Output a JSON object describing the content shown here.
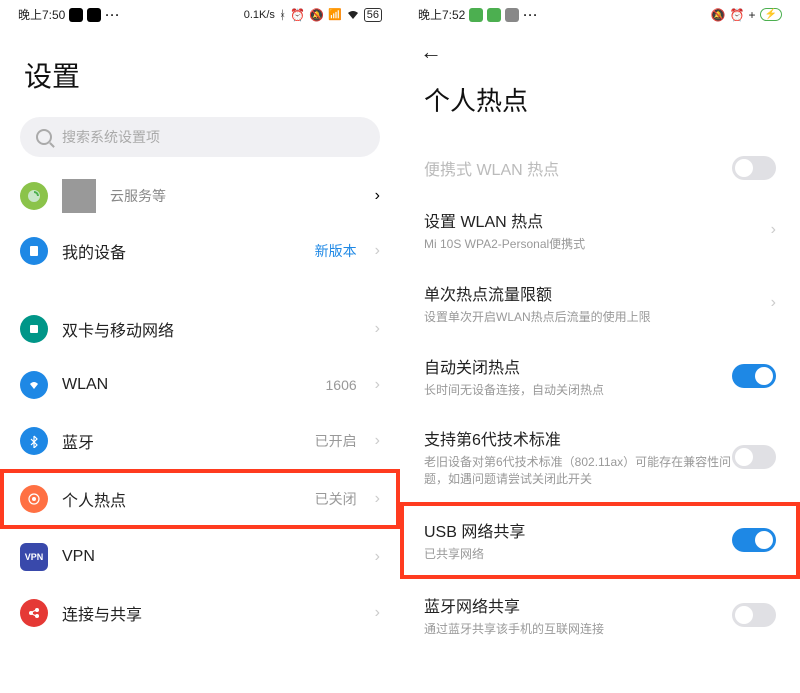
{
  "left": {
    "status": {
      "time": "晚上7:50",
      "speed": "0.1K/s",
      "net_badge": "56"
    },
    "title": "设置",
    "search_placeholder": "搜索系统设置项",
    "cloud_label": "云服务等",
    "rows": [
      {
        "label": "我的设备",
        "value": "新版本",
        "badge": true
      },
      {
        "label": "双卡与移动网络",
        "value": ""
      },
      {
        "label": "WLAN",
        "value": "1606"
      },
      {
        "label": "蓝牙",
        "value": "已开启"
      },
      {
        "label": "个人热点",
        "value": "已关闭"
      },
      {
        "label": "VPN",
        "value": ""
      },
      {
        "label": "连接与共享",
        "value": ""
      }
    ]
  },
  "right": {
    "status": {
      "time": "晚上7:52"
    },
    "title": "个人热点",
    "items": [
      {
        "main": "便携式 WLAN 热点",
        "sub": "",
        "toggle": "off",
        "disabled": true
      },
      {
        "main": "设置 WLAN 热点",
        "sub": "Mi 10S WPA2-Personal便携式",
        "chev": true
      },
      {
        "main": "单次热点流量限额",
        "sub": "设置单次开启WLAN热点后流量的使用上限",
        "chev": true
      },
      {
        "main": "自动关闭热点",
        "sub": "长时间无设备连接，自动关闭热点",
        "toggle": "on"
      },
      {
        "main": "支持第6代技术标准",
        "sub": "老旧设备对第6代技术标准（802.11ax）可能存在兼容性问题，如遇问题请尝试关闭此开关",
        "toggle": "off"
      },
      {
        "main": "USB 网络共享",
        "sub": "已共享网络",
        "toggle": "on"
      },
      {
        "main": "蓝牙网络共享",
        "sub": "通过蓝牙共享该手机的互联网连接",
        "toggle": "off"
      }
    ]
  }
}
